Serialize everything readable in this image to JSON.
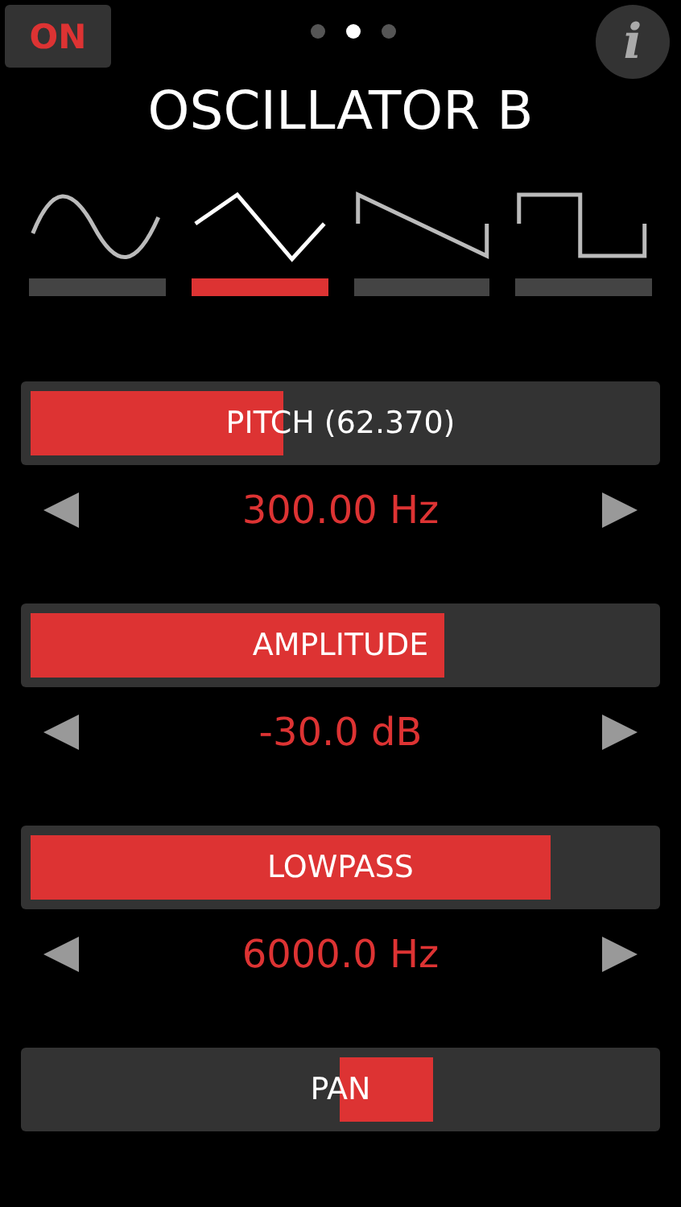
{
  "power": {
    "label": "ON",
    "on": true
  },
  "pages": [
    {
      "selected": false
    },
    {
      "selected": true
    },
    {
      "selected": false
    }
  ],
  "info": {
    "label": "i"
  },
  "title": "OSCILLATOR B",
  "waveforms": [
    {
      "kind": "sine",
      "selected": false
    },
    {
      "kind": "triangle",
      "selected": true
    },
    {
      "kind": "saw",
      "selected": false
    },
    {
      "kind": "square",
      "selected": false
    }
  ],
  "controls": [
    {
      "kind": "unipolar",
      "label": "PITCH (62.370)",
      "level": 0.41,
      "reading": "300.00 Hz"
    },
    {
      "kind": "unipolar",
      "label": "AMPLITUDE",
      "level": 0.67,
      "reading": "-30.0 dB"
    },
    {
      "kind": "unipolar",
      "label": "LOWPASS",
      "level": 0.84,
      "reading": "6000.0 Hz"
    },
    {
      "kind": "bipolar",
      "label": "PAN"
    }
  ]
}
